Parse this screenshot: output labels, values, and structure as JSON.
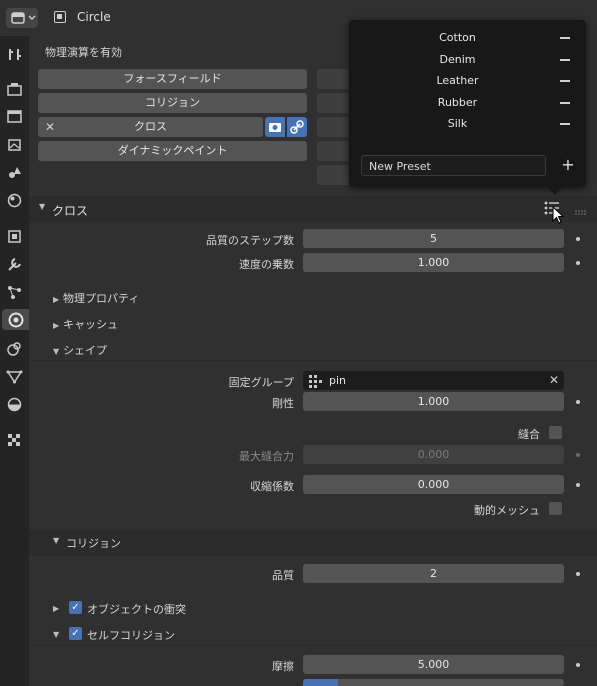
{
  "header": {
    "object_name": "Circle"
  },
  "physics": {
    "title": "物理演算を有効",
    "buttons_left": [
      "フォースフィールド",
      "コリジョン",
      "クロス",
      "ダイナミックペイント"
    ]
  },
  "cloth": {
    "title": "クロス",
    "quality_steps_label": "品質のステップ数",
    "quality_steps_value": "5",
    "speed_label": "速度の乗数",
    "speed_value": "1.000",
    "sub_physical": "物理プロパティ",
    "sub_cache": "キャッシュ",
    "sub_shape": "シェイプ",
    "pin_group_label": "固定グループ",
    "pin_group_value": "pin",
    "stiffness_label": "剛性",
    "stiffness_value": "1.000",
    "sewing_label": "縫合",
    "max_sewing_label": "最大縫合力",
    "max_sewing_value": "0.000",
    "shrink_label": "収縮係数",
    "shrink_value": "0.000",
    "dynamic_mesh_label": "動的メッシュ",
    "collision_title": "コリジョン",
    "collision_quality_label": "品質",
    "collision_quality_value": "2",
    "object_collision_label": "オブジェクトの衝突",
    "self_collision_label": "セルフコリジョン",
    "friction_label": "摩擦",
    "friction_value": "5.000"
  },
  "presets": {
    "items": [
      "Cotton",
      "Denim",
      "Leather",
      "Rubber",
      "Silk"
    ],
    "new_preset_placeholder": "New Preset"
  }
}
